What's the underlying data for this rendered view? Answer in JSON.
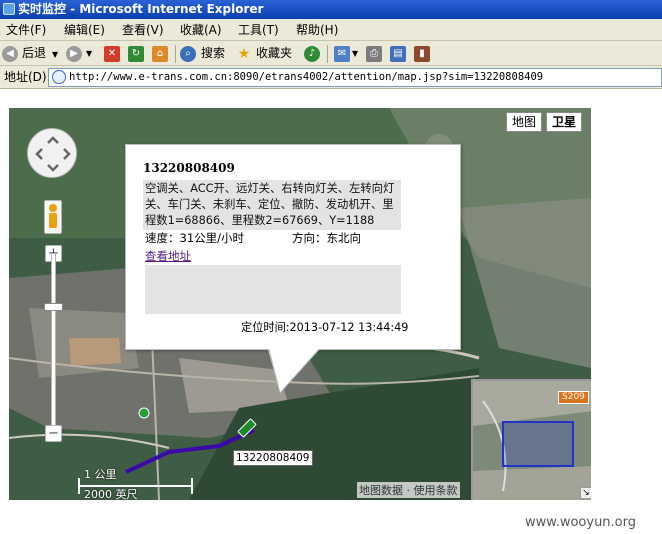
{
  "window": {
    "title": "实时监控 - Microsoft Internet Explorer"
  },
  "menu": [
    "文件(F)",
    "编辑(E)",
    "查看(V)",
    "收藏(A)",
    "工具(T)",
    "帮助(H)"
  ],
  "toolbar": {
    "back_label": "后退",
    "search_label": "搜索",
    "favorites_label": "收藏夹"
  },
  "address": {
    "label": "地址(D)",
    "url": "http://www.e-trans.com.cn:8090/etrans4002/attention/map.jsp?sim=13220808409"
  },
  "map": {
    "type_map": "地图",
    "type_satellite": "卫星",
    "zoom_in": "+",
    "zoom_out": "−",
    "scale_metric": "1 公里",
    "scale_imperial": "2000 英尺",
    "copyright": "地图数据 · 使用条款",
    "vehicle_label": "13220808409",
    "overview": {
      "road_badge": "S209"
    },
    "infowindow": {
      "title": "13220808409",
      "status": "空调关、ACC开、远灯关、右转向灯关、左转向灯关、车门关、未刹车、定位、撤防、发动机开、里程数1=68866、里程数2=67669、Y=1188",
      "speed": "速度：31公里/小时",
      "direction": "方向：东北向",
      "view_address_link": "查看地址",
      "locate_time": "定位时间:2013-07-12 13:44:49"
    }
  },
  "watermark": "www.wooyun.org"
}
